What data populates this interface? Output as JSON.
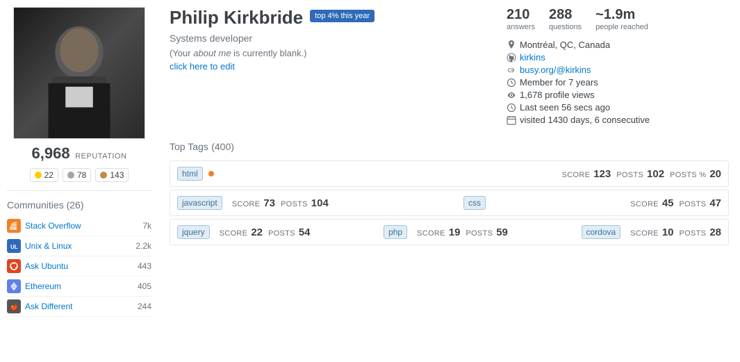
{
  "sidebar": {
    "reputation": "6,968",
    "reputation_label": "REPUTATION",
    "badges": {
      "gold": {
        "count": "22"
      },
      "silver": {
        "count": "78"
      },
      "bronze": {
        "count": "143"
      }
    },
    "communities_label": "Communities",
    "communities_count": "(26)",
    "communities": [
      {
        "name": "Stack Overflow",
        "score": "7k",
        "icon_type": "so"
      },
      {
        "name": "Unix & Linux",
        "score": "2.2k",
        "icon_type": "ul"
      },
      {
        "name": "Ask Ubuntu",
        "score": "443",
        "icon_type": "au"
      },
      {
        "name": "Ethereum",
        "score": "405",
        "icon_type": "eth"
      },
      {
        "name": "Ask Different",
        "score": "244",
        "icon_type": "ad"
      }
    ]
  },
  "profile": {
    "name": "Philip Kirkbride",
    "top_badge": "top 4% this year",
    "title": "Systems developer",
    "about_blank": "(Your about me is currently blank.)",
    "edit_link": "click here to edit",
    "stats": [
      {
        "number": "210",
        "label": "answers"
      },
      {
        "number": "288",
        "label": "questions"
      },
      {
        "number": "~1.9m",
        "label": "people reached"
      }
    ],
    "meta": [
      {
        "icon": "location",
        "text": "Montréal, QC, Canada",
        "link": false
      },
      {
        "icon": "github",
        "text": "kirkins",
        "link": true
      },
      {
        "icon": "link",
        "text": "busy.org/@kirkins",
        "link": true
      },
      {
        "icon": "clock",
        "text": "Member for 7 years",
        "link": false
      },
      {
        "icon": "eye",
        "text": "1,678 profile views",
        "link": false
      },
      {
        "icon": "clock2",
        "text": "Last seen 56 secs ago",
        "link": false
      },
      {
        "icon": "calendar",
        "text": "visited 1430 days, 6 consecutive",
        "link": false
      }
    ]
  },
  "top_tags": {
    "label": "Top Tags",
    "count": "(400)",
    "tags": [
      {
        "name": "html",
        "dot": true,
        "score_label": "SCORE",
        "score": "123",
        "posts_label": "POSTS",
        "posts": "102",
        "posts_pct_label": "POSTS %",
        "posts_pct": "20",
        "cols": "wide"
      },
      {
        "name": "javascript",
        "dot": false,
        "score_label": "SCORE",
        "score": "73",
        "posts_label": "POSTS",
        "posts": "104",
        "name2": "css",
        "score_label2": "SCORE",
        "score2": "45",
        "posts_label2": "POSTS",
        "posts2": "47",
        "cols": "double"
      },
      {
        "name": "jquery",
        "dot": false,
        "score_label": "SCORE",
        "score": "22",
        "posts_label": "POSTS",
        "posts": "54",
        "name2": "php",
        "score_label2": "SCORE",
        "score2": "19",
        "posts_label2": "POSTS",
        "posts2": "59",
        "name3": "cordova",
        "score_label3": "SCORE",
        "score3": "10",
        "posts_label3": "POSTS",
        "posts3": "28",
        "cols": "triple"
      }
    ]
  }
}
